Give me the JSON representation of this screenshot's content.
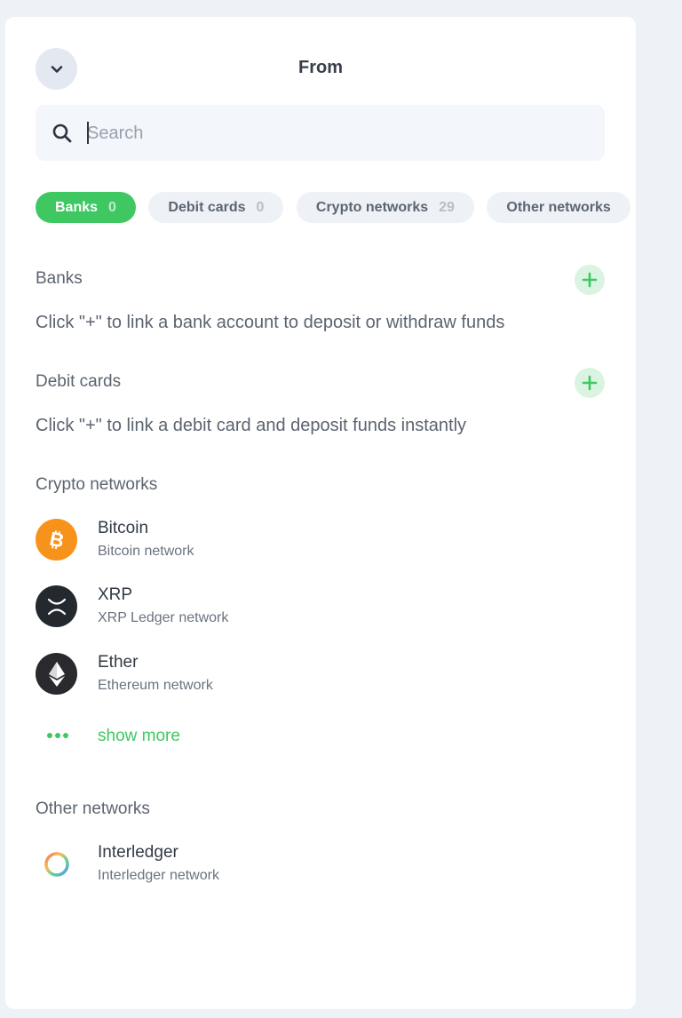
{
  "header": {
    "title": "From"
  },
  "search": {
    "placeholder": "Search",
    "value": ""
  },
  "tabs": [
    {
      "label": "Banks",
      "count": "0",
      "active": true
    },
    {
      "label": "Debit cards",
      "count": "0",
      "active": false
    },
    {
      "label": "Crypto networks",
      "count": "29",
      "active": false
    },
    {
      "label": "Other networks",
      "count": "",
      "active": false
    }
  ],
  "banks": {
    "title": "Banks",
    "hint": "Click \"+\" to link a bank account to deposit or withdraw funds"
  },
  "debit_cards": {
    "title": "Debit cards",
    "hint": "Click \"+\" to link a debit card and deposit funds instantly"
  },
  "crypto": {
    "title": "Crypto networks",
    "items": [
      {
        "name": "Bitcoin",
        "subtitle": "Bitcoin network",
        "icon": "bitcoin-icon",
        "color": "#f7931a"
      },
      {
        "name": "XRP",
        "subtitle": "XRP Ledger network",
        "icon": "xrp-icon",
        "color": "#23292f"
      },
      {
        "name": "Ether",
        "subtitle": "Ethereum network",
        "icon": "ethereum-icon",
        "color": "#2a2a2e"
      }
    ],
    "show_more": "show more"
  },
  "other": {
    "title": "Other networks",
    "items": [
      {
        "name": "Interledger",
        "subtitle": "Interledger network",
        "icon": "interledger-icon"
      }
    ]
  },
  "colors": {
    "accent": "#3fc862",
    "panel": "#ffffff",
    "background": "#eef1f6"
  }
}
